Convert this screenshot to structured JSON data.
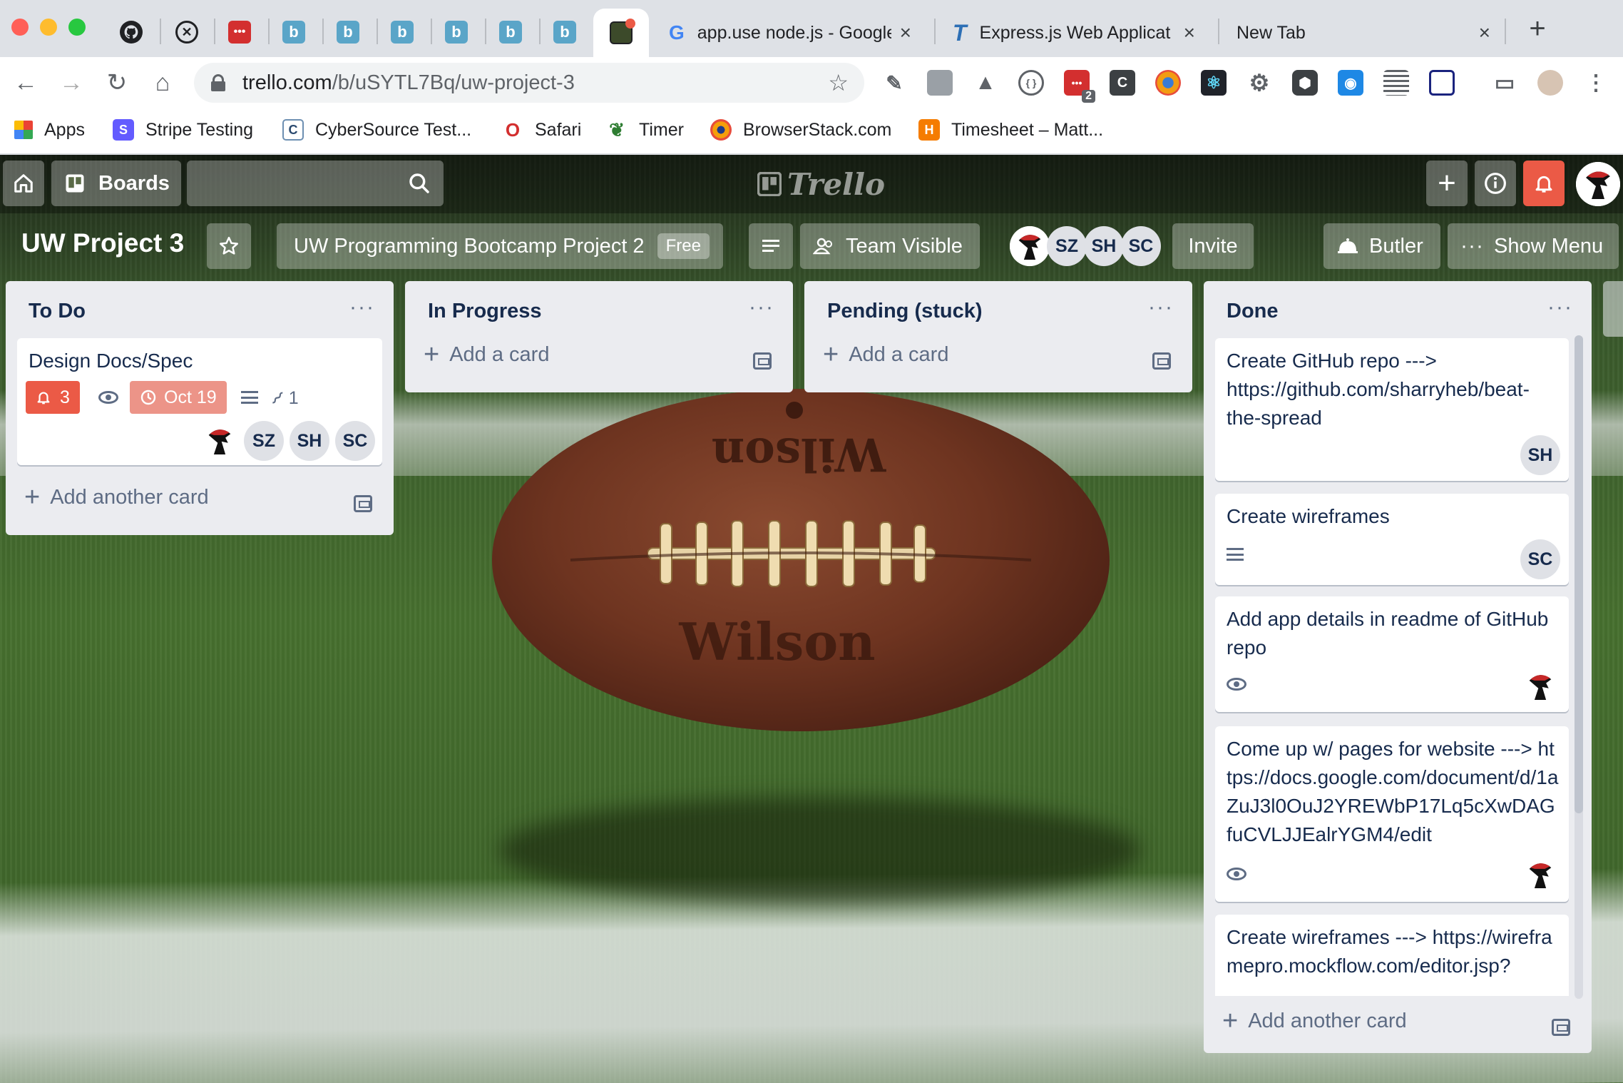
{
  "browser": {
    "tabs": [
      {
        "title": "app.use node.js - Google",
        "close": "×"
      },
      {
        "title": "Express.js Web Applicat",
        "close": "×"
      },
      {
        "title": "New Tab",
        "close": "×"
      }
    ],
    "new_tab": "+",
    "url_host": "trello.com",
    "url_path": "/b/uSYTL7Bq/uw-project-3",
    "ext_badge": "2",
    "bookmarks": [
      {
        "label": "Apps"
      },
      {
        "label": "Stripe Testing"
      },
      {
        "label": "CyberSource Test..."
      },
      {
        "label": "Safari"
      },
      {
        "label": "Timer"
      },
      {
        "label": "BrowserStack.com"
      },
      {
        "label": "Timesheet – Matt..."
      }
    ]
  },
  "trello": {
    "boards_label": "Boards",
    "logo": "Trello",
    "board_title": "UW Project 3",
    "team_name": "UW Programming Bootcamp Project 2",
    "team_plan": "Free",
    "visibility": "Team Visible",
    "members": [
      "SZ",
      "SH",
      "SC"
    ],
    "invite": "Invite",
    "butler": "Butler",
    "show_menu": "Show Menu",
    "colors": {
      "notification": "#eb5a46",
      "due": "#ec9488"
    }
  },
  "lists": [
    {
      "title": "To Do",
      "add_label": "Add another card",
      "cards": [
        {
          "text": "Design Docs/Spec",
          "notifications": "3",
          "due": "Oct 19",
          "attachments": "1",
          "members": [
            "SZ",
            "SH",
            "SC"
          ]
        }
      ]
    },
    {
      "title": "In Progress",
      "add_label": "Add a card",
      "cards": []
    },
    {
      "title": "Pending (stuck)",
      "add_label": "Add a card",
      "cards": []
    },
    {
      "title": "Done",
      "add_label": "Add another card",
      "cards": [
        {
          "text": "Create GitHub repo ---> https://github.com/sharryheb/beat-the-spread",
          "members": [
            "SH"
          ]
        },
        {
          "text": "Create wireframes",
          "members": [
            "SC"
          ]
        },
        {
          "text": "Add app details in readme of GitHub repo"
        },
        {
          "text": "Come up w/ pages for website ---> https://docs.google.com/document/d/1aZuJ3l0OuJ2YREWbP17Lq5cXwDAGfuCVLJJEalrYGM4/edit"
        },
        {
          "text": "Create wireframes ---> https://wireframepro.mockflow.com/editor.jsp?"
        }
      ]
    }
  ]
}
